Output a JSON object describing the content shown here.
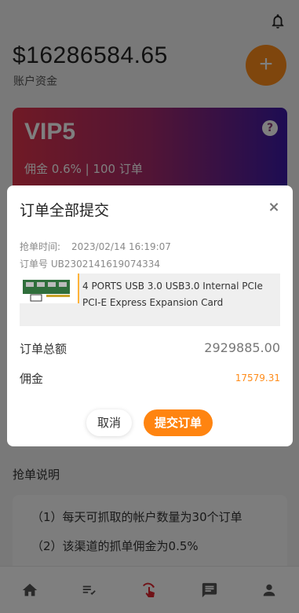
{
  "header": {
    "balance": "$16286584.65",
    "balance_label": "账户资金",
    "fab_label": "+"
  },
  "vip": {
    "title": "VIP5",
    "help": "?",
    "subtitle": "佣金 0.6% | 100 订单"
  },
  "rules": {
    "title": "抢单说明",
    "items": [
      "（1）每天可抓取的帐户数量为30个订单",
      "（2）该渠道的抓单佣金为0.5%"
    ]
  },
  "modal": {
    "title": "订单全部提交",
    "close": "×",
    "grab_time_label": "抢单时间:",
    "grab_time_value": "2023/02/14 16:19:07",
    "order_no": "订单号 UB2302141619074334",
    "product_name": "4 PORTS USB 3.0 USB3.0 Internal PCIe PCI-E Express Expansion Card",
    "total_label": "订单总额",
    "total_value": "2929885.00",
    "commission_label": "佣金",
    "commission_value": "17579.31",
    "cancel_label": "取消",
    "submit_label": "提交订单"
  },
  "tabbar": {
    "items": [
      "home-icon",
      "list-check-icon",
      "grab-order-icon",
      "message-icon",
      "profile-icon"
    ]
  },
  "colors": {
    "accent": "#ff8410",
    "vip_gradient_start": "#e0344b",
    "vip_gradient_end": "#3b1aa6"
  }
}
